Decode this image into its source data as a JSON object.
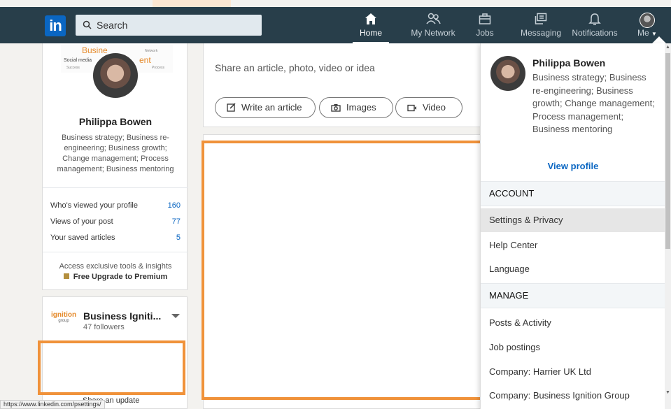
{
  "navbar": {
    "logo": "in",
    "search_placeholder": "Search",
    "items": [
      {
        "label": "Home",
        "icon": "home-icon"
      },
      {
        "label": "My Network",
        "icon": "network-icon"
      },
      {
        "label": "Jobs",
        "icon": "briefcase-icon"
      },
      {
        "label": "Messaging",
        "icon": "messaging-icon"
      },
      {
        "label": "Notifications",
        "icon": "bell-icon"
      },
      {
        "label": "Me",
        "icon": "avatar"
      }
    ]
  },
  "profile": {
    "name": "Philippa Bowen",
    "headline": "Business strategy; Business re-engineering; Business growth; Change management; Process management; Business mentoring",
    "stats": [
      {
        "label": "Who's viewed your profile",
        "value": "160"
      },
      {
        "label": "Views of your post",
        "value": "77"
      },
      {
        "label": "Your saved articles",
        "value": "5"
      }
    ],
    "premium_text": "Access exclusive tools & insights",
    "premium_link": "Free Upgrade to Premium"
  },
  "company": {
    "name": "Business Igniti...",
    "followers": "47 followers",
    "logo_text": "ignition",
    "logo_sub": "group",
    "share_update": "Share an update"
  },
  "share": {
    "prompt": "Share an article, photo, video or idea",
    "buttons": [
      {
        "label": "Write an article",
        "icon": "pencil-icon"
      },
      {
        "label": "Images",
        "icon": "camera-icon"
      },
      {
        "label": "Video",
        "icon": "video-icon"
      }
    ]
  },
  "dropdown": {
    "name": "Philippa Bowen",
    "headline": "Business strategy; Business re-engineering; Business growth; Change management; Process management; Business mentoring",
    "view_profile": "View profile",
    "account_header": "ACCOUNT",
    "account_items": [
      "Settings & Privacy",
      "Help Center",
      "Language"
    ],
    "manage_header": "MANAGE",
    "manage_items": [
      "Posts & Activity",
      "Job postings",
      "Company: Harrier UK Ltd",
      "Company: Business Ignition Group"
    ]
  },
  "status_url": "https://www.linkedin.com/psettings/",
  "colors": {
    "navbar": "#283e4a",
    "brand": "#0a66c2",
    "highlight_box": "#f0923a"
  }
}
